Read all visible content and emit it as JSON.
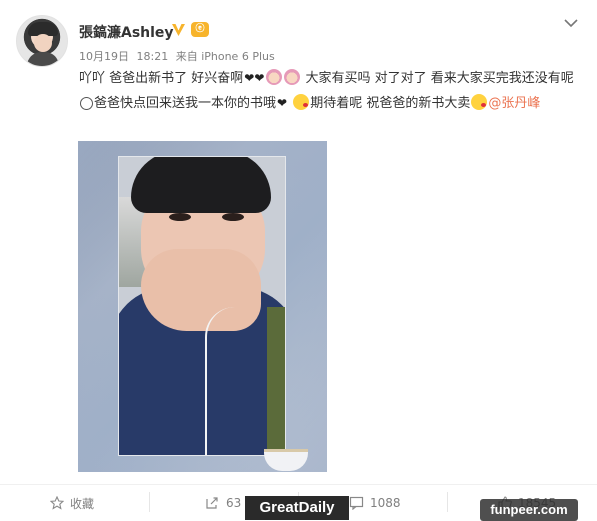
{
  "post": {
    "username": "張鎬濂Ashley",
    "vip_badge": "ⓔ",
    "date": "10月19日",
    "time": "18:21",
    "source": "来自 iPhone 6 Plus",
    "text_1": "吖吖 爸爸出新书了 好兴奋啊",
    "text_2": "大家有买吗 对了对了 看来大家买完我还没有呢",
    "text_3": "爸爸快点回来送我一本你的书哦",
    "text_4": "期待着呢 祝爸爸的新书大卖",
    "mention": "@张丹峰"
  },
  "actions": {
    "favorite_label": "收藏",
    "repost_count": "63",
    "comment_count": "1088",
    "like_count": "18545"
  },
  "watermarks": {
    "left": "GreatDaily",
    "right": "funpeer.com"
  },
  "colors": {
    "mention": "#eb7350",
    "verified": "#f7b42c"
  },
  "icons": {
    "verified": "verified-v-icon",
    "chevron": "chevron-down-icon",
    "favorite": "star-icon",
    "repost": "share-icon",
    "comment": "comment-icon",
    "like": "thumbs-up-icon"
  }
}
